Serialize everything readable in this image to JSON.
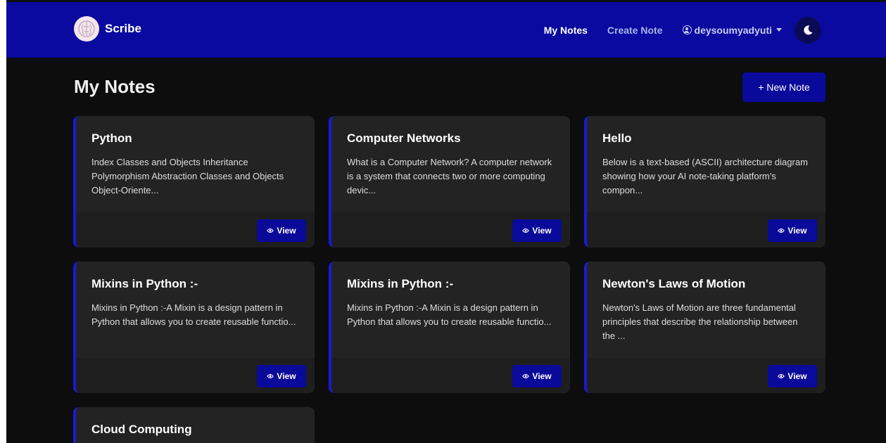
{
  "nav": {
    "brand": "Scribe",
    "links": [
      "My Notes",
      "Create Note"
    ],
    "user": "deysoumyadyuti"
  },
  "main": {
    "title": "My Notes",
    "new_note_label": "+ New Note",
    "view_label": "View",
    "notes": [
      {
        "title": "Python",
        "excerpt": "Index Classes and Objects Inheritance Polymorphism Abstraction Classes and Objects Object-Oriente..."
      },
      {
        "title": "Computer Networks",
        "excerpt": "What is a Computer Network? A computer network is a system that connects two or more computing devic..."
      },
      {
        "title": "Hello",
        "excerpt": "Below is a text-based (ASCII) architecture diagram showing how your AI note-taking platform's compon..."
      },
      {
        "title": "Mixins in Python :-",
        "excerpt": "Mixins in Python :-A Mixin is a design pattern in Python that allows you to create reusable functio..."
      },
      {
        "title": "Mixins in Python :-",
        "excerpt": "Mixins in Python :-A Mixin is a design pattern in Python that allows you to create reusable functio..."
      },
      {
        "title": "Newton's Laws of Motion",
        "excerpt": "Newton's Laws of Motion are three fundamental principles that describe the relationship between the ..."
      },
      {
        "title": "Cloud Computing",
        "excerpt": ""
      }
    ]
  },
  "colors": {
    "navbar": "#0a0aa0",
    "accent": "#1a1ad2",
    "button": "#0a0a9a",
    "card": "#232323",
    "background": "#0d0d0d"
  },
  "icons": {
    "logo": "brain-logo-icon",
    "user": "user-circle-icon",
    "theme": "moon-icon",
    "view": "eye-icon"
  }
}
